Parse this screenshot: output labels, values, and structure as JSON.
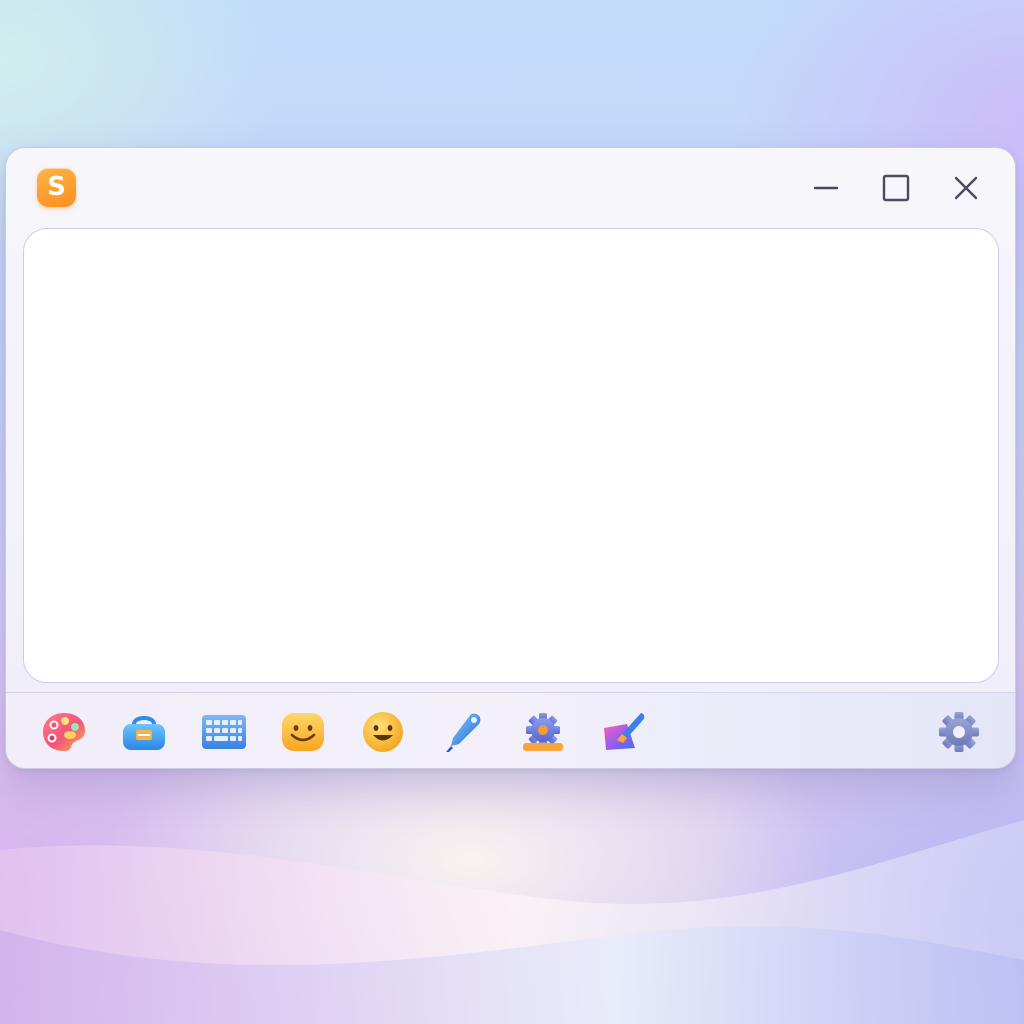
{
  "window": {
    "logo_letter": "S",
    "controls": {
      "minimize_icon": "minimize-icon",
      "maximize_icon": "maximize-icon",
      "close_icon": "close-icon"
    }
  },
  "editor": {
    "content": ""
  },
  "toolbar": {
    "tools": [
      {
        "icon": "palette-icon"
      },
      {
        "icon": "toolbox-icon"
      },
      {
        "icon": "keyboard-icon"
      },
      {
        "icon": "emoticon-icon"
      },
      {
        "icon": "emoji-icon"
      },
      {
        "icon": "pen-icon"
      },
      {
        "icon": "gear-tools-icon"
      },
      {
        "icon": "brush-icon"
      }
    ],
    "settings_icon": "settings-gear-icon"
  },
  "colors": {
    "accent_orange": "#f7901e",
    "window_bg": "#f5f4fa",
    "control_icon": "#4a4a5e"
  }
}
